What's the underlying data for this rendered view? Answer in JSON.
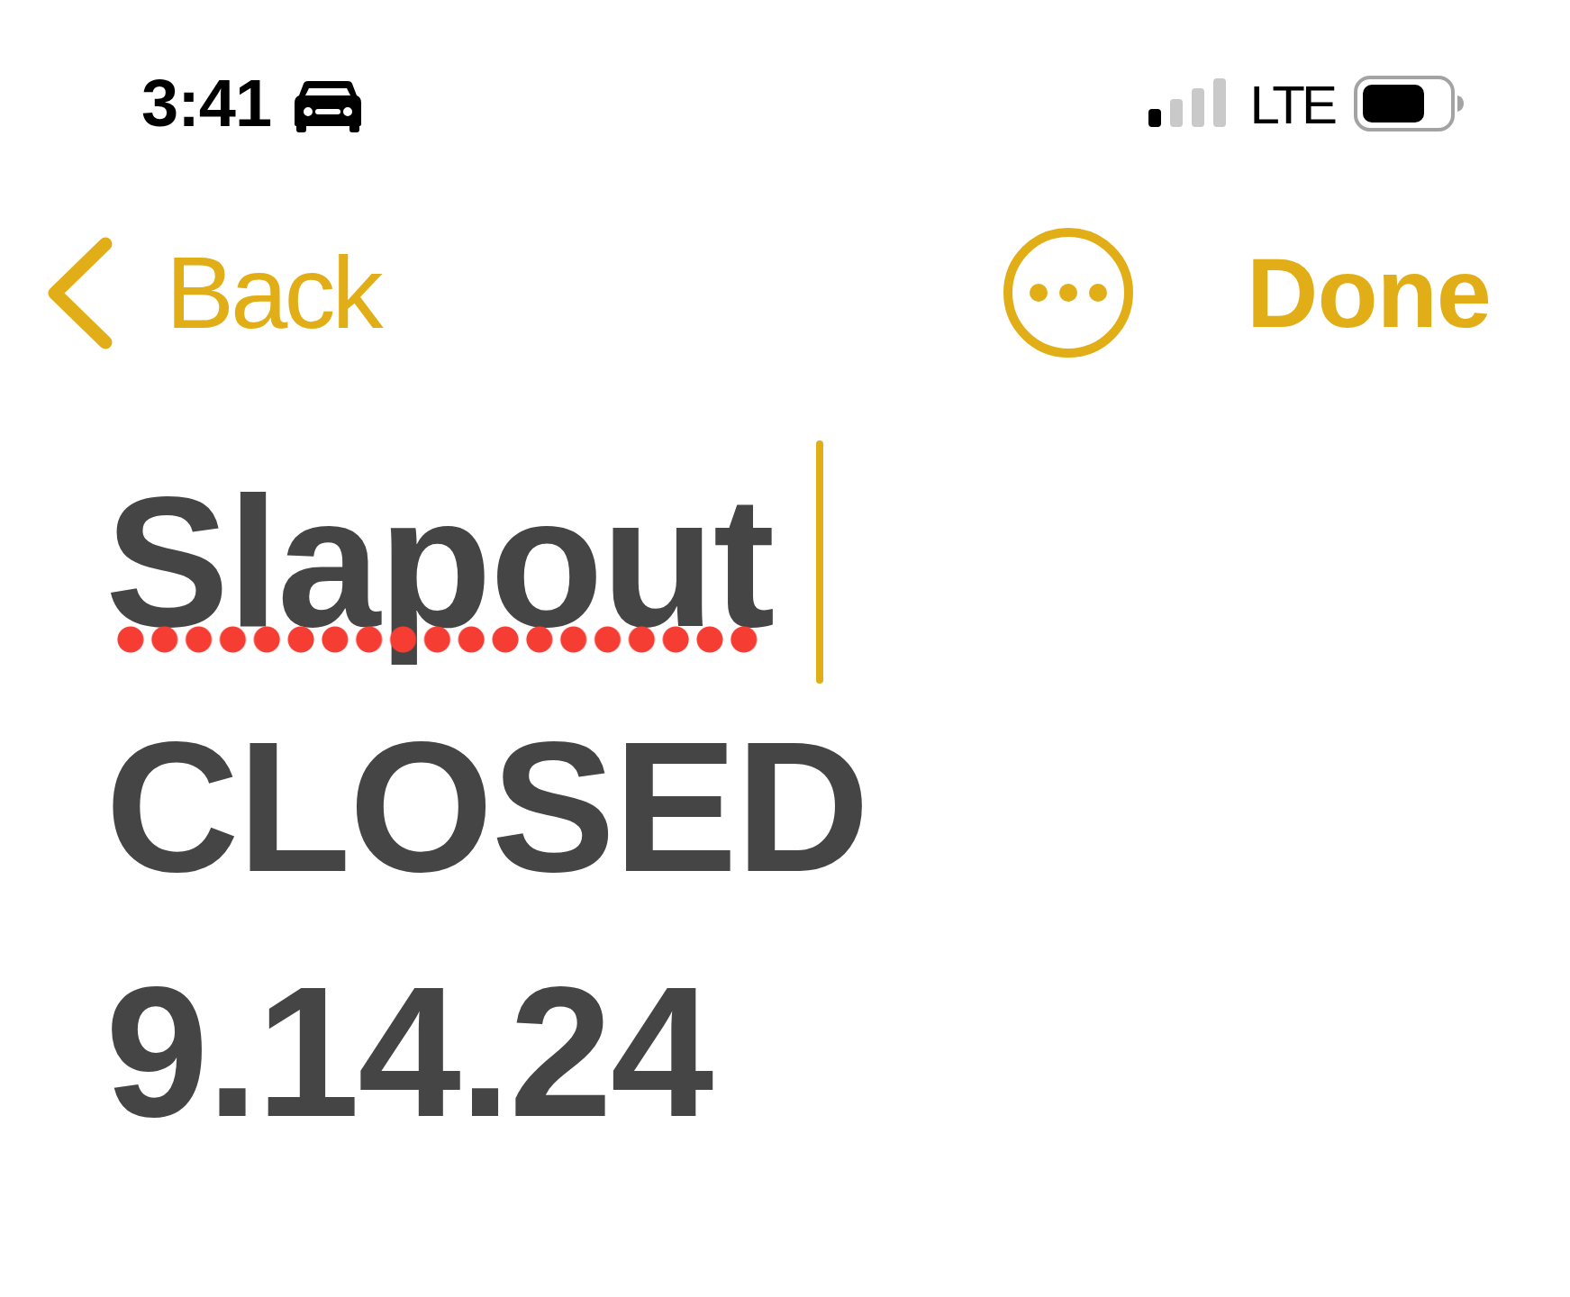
{
  "status_bar": {
    "time": "3:41",
    "network": "LTE"
  },
  "nav_bar": {
    "back": {
      "label": "Back"
    },
    "done": {
      "label": "Done"
    }
  },
  "note": {
    "lines": [
      {
        "text": "Slapout",
        "misspelled": true,
        "cursor": true
      },
      {
        "text": "CLOSED",
        "misspelled": false,
        "cursor": false
      },
      {
        "text": "9.14.24",
        "misspelled": false,
        "cursor": false
      }
    ]
  }
}
